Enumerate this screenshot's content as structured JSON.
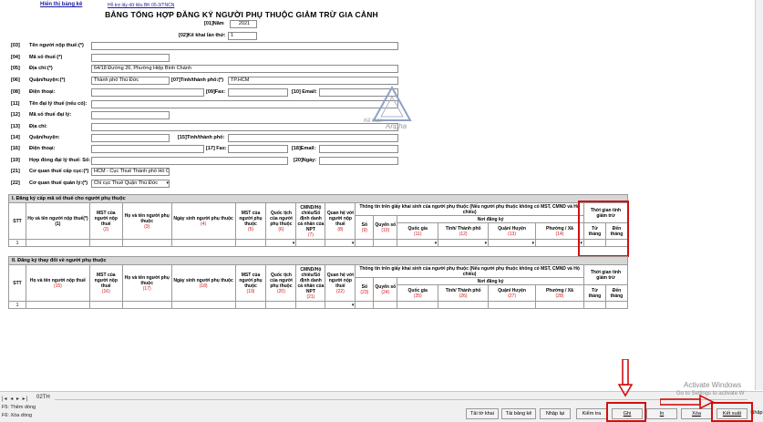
{
  "nav": {
    "link": "Hiển thị bảng kê",
    "sub": "Hỗ trợ lấy dữ liệu BK 05-3/TNCN"
  },
  "form": {
    "title": "BẢNG TỔNG HỢP ĐĂNG KÝ NGƯỜI PHỤ THUỘC GIẢM TRỪ GIA CẢNH",
    "year_label": "[01]Năm",
    "year_value": "2021",
    "times_label": "[02]Kê khai lần thứ:",
    "times_value": "1"
  },
  "fields": {
    "f03": {
      "num": "[03]",
      "label": "Tên người nộp thuế:(*)",
      "value": ""
    },
    "f04": {
      "num": "[04]",
      "label": "Mã số thuế:(*)",
      "value": ""
    },
    "f05": {
      "num": "[05]",
      "label": "Địa chỉ:(*)",
      "value": "64/18 Đường 26, Phường Hiệp Bình Chánh"
    },
    "f06": {
      "num": "[06]",
      "label": "Quận/huyện:(*)",
      "value": "Thành phố Thủ Đức",
      "label2": "[07]Tỉnh/thành phố:(*)",
      "value2": "TP.HCM"
    },
    "f08": {
      "num": "[08]",
      "label": "Điện thoại:",
      "value": "",
      "label2": "[09]Fax:",
      "value2": "",
      "label3": "[10] Email:",
      "value3": ""
    },
    "f11": {
      "num": "[11]",
      "label": "Tên đại lý thuế (nếu có):",
      "value": ""
    },
    "f12": {
      "num": "[12]",
      "label": "Mã số thuế đại lý:",
      "value": ""
    },
    "f13": {
      "num": "[13]",
      "label": "Địa chỉ:",
      "value": ""
    },
    "f14": {
      "num": "[14]",
      "label": "Quận/huyện:",
      "value": "",
      "label2": "[15]Tỉnh/thành phố:",
      "value2": ""
    },
    "f16": {
      "num": "[16]",
      "label": "Điện thoại:",
      "value": "",
      "label2": "[17] Fax:",
      "value2": "",
      "label3": "[18]Email:",
      "value3": ""
    },
    "f19": {
      "num": "[19]",
      "label": "Hợp đồng đại lý thuế: Số:",
      "value": "",
      "label2": "[20]Ngày:",
      "value2": ""
    },
    "f21": {
      "num": "[21]",
      "label": "Cơ quan thuế cấp cục:(*)",
      "value": "HCM - Cục Thuế Thành phố Hồ Chí"
    },
    "f22": {
      "num": "[22]",
      "label": "Cơ quan thuế quản lý:(*)",
      "value": "Chi cục Thuế Quận Thủ Đức"
    }
  },
  "section1": {
    "title": "I. Đăng ký cấp mã số thuế cho người phụ thuộc",
    "stt": "STT",
    "cols": [
      {
        "label": "Họ và tên người nộp thuế(*)",
        "num": "(1)"
      },
      {
        "label": "MST của người nộp thuế",
        "num": "(2)"
      },
      {
        "label": "Họ và tên người phụ thuộc",
        "num": "(3)"
      },
      {
        "label": "Ngày sinh người phụ thuộc",
        "num": "(4)"
      },
      {
        "label": "MST của người phụ thuộc",
        "num": "(5)"
      },
      {
        "label": "Quốc tịch của người phụ thuộc",
        "num": "(6)"
      },
      {
        "label": "CMND/Hộ chiếu/Số định danh cá nhân của NPT",
        "num": "(7)"
      },
      {
        "label": "Quan hệ với người nộp thuế",
        "num": "(8)"
      }
    ],
    "birth_info": "Thông tin trên giấy khai sinh của người phụ thuộc (Nếu người phụ thuộc không có MST, CMND và Hộ chiếu)",
    "so": {
      "label": "Số",
      "num": "(9)"
    },
    "quyenso": {
      "label": "Quyển số",
      "num": "(10)"
    },
    "noidangky": "Nơi đăng ký",
    "sub": [
      {
        "label": "Quốc gia",
        "num": "(11)"
      },
      {
        "label": "Tỉnh/ Thành phố",
        "num": "(12)"
      },
      {
        "label": "Quận/ Huyện",
        "num": "(13)"
      },
      {
        "label": "Phường / Xã",
        "num": "(14)"
      }
    ],
    "time": "Thời gian tính giảm trừ",
    "from": "Từ tháng",
    "to": "Đến tháng",
    "row1": "1"
  },
  "section2": {
    "title": "II. Đăng ký thay đổi về người phụ thuộc",
    "stt": "STT",
    "cols": [
      {
        "label": "Họ và tên người nộp thuế",
        "num": "(15)"
      },
      {
        "label": "MST của người nộp thuế",
        "num": "(16)"
      },
      {
        "label": "Họ và tên người phụ thuộc",
        "num": "(17)"
      },
      {
        "label": "Ngày sinh người phụ thuộc",
        "num": "(18)"
      },
      {
        "label": "MST của người phụ thuộc",
        "num": "(19)"
      },
      {
        "label": "Quốc tịch của người phụ thuộc",
        "num": "(20)"
      },
      {
        "label": "CMND/Hộ chiếu/Số định danh cá nhân của NPT",
        "num": "(21)"
      },
      {
        "label": "Quan hệ với người nộp thuế",
        "num": "(22)"
      }
    ],
    "birth_info": "Thông tin trên giấy khai sinh của người phụ thuộc (Nếu người phụ thuộc không có MST, CMND và Hộ chiếu)",
    "so": {
      "label": "Số",
      "num": "(23)"
    },
    "quyenso": {
      "label": "Quyển số",
      "num": "(24)"
    },
    "noidangky": "Nơi đăng ký",
    "sub": [
      {
        "label": "Quốc gia",
        "num": "(25)"
      },
      {
        "label": "Tỉnh/ Thành phố",
        "num": "(26)"
      },
      {
        "label": "Quận/ Huyện",
        "num": "(27)"
      },
      {
        "label": "Phường / Xã",
        "num": "(28)"
      }
    ],
    "time": "Thời gian tính giảm trừ",
    "from": "Từ tháng",
    "to": "Đến tháng",
    "row1": "1"
  },
  "footer": {
    "sheet_tab": "02TH",
    "hint1": "F5: Thêm dòng",
    "hint2": "F6: Xóa dòng",
    "buttons": [
      "Tải tờ khai",
      "Tải bảng kê",
      "Nhập lại",
      "Kiểm tra",
      "Ghi",
      "In",
      "Xóa",
      "Kết xuất",
      "Nhập"
    ],
    "activate_title": "Activate Windows",
    "activate_sub": "Go to Settings to activate W"
  },
  "watermark": {
    "text": "Anpha",
    "sub": "Kế toán"
  },
  "colors": {
    "highlight": "#d01010",
    "link": "#1a1a9c"
  }
}
